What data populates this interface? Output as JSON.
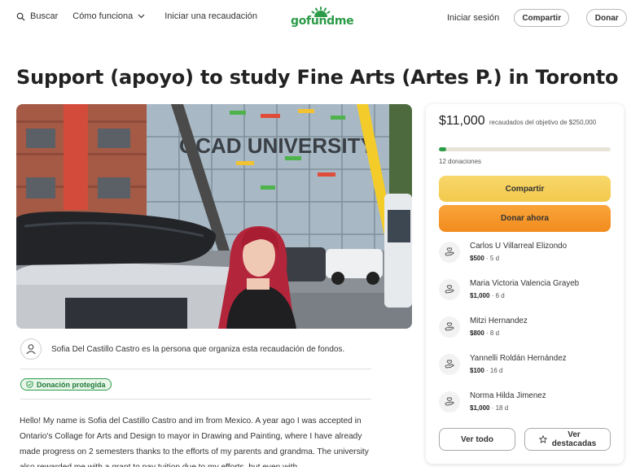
{
  "header": {
    "search_label": "Buscar",
    "how_it_works_label": "Cómo funciona",
    "start_fundraiser_label": "Iniciar una recaudación",
    "logo_text": "gofundme",
    "signin_label": "Iniciar sesión",
    "share_label": "Compartir",
    "donate_label": "Donar"
  },
  "campaign": {
    "title": "Support (apoyo) to study Fine Arts (Artes P.) in Toronto",
    "photo_sign_text": "OCAD UNIVERSITY",
    "organizer_text": "Sofia Del Castillo Castro es la persona que organiza esta recaudación de fondos.",
    "badge_label": "Donación protegida",
    "story": "Hello! My name is Sofia del Castillo Castro and im from Mexico. A year ago I was accepted in Ontario's Collage for Arts and Design to mayor in Drawing and Painting, where I have already made progress on 2 semesters thanks to the efforts of my parents and grandma. The university also rewarded me with a grant to pay tuition due to my efforts, but even with"
  },
  "sidebar": {
    "raised_amount": "$11,000",
    "raised_text": "recaudados del objetivo de $250,000",
    "progress_fraction": 0.044,
    "donation_count": "12 donaciones",
    "share_button": "Compartir",
    "donate_button": "Donar ahora",
    "donations": [
      {
        "name": "Carlos U Villarreal Elizondo",
        "amount": "$500",
        "time": "5 d"
      },
      {
        "name": "Maria Victoria Valencia Grayeb",
        "amount": "$1,000",
        "time": "6 d"
      },
      {
        "name": "Mitzi Hernandez",
        "amount": "$800",
        "time": "8 d"
      },
      {
        "name": "Yannelli Roldán Hernández",
        "amount": "$100",
        "time": "16 d"
      },
      {
        "name": "Norma Hilda Jimenez",
        "amount": "$1,000",
        "time": "18 d"
      }
    ],
    "see_all_button": "Ver todo",
    "see_top_line1": "Ver",
    "see_top_line2": "destacadas"
  },
  "colors": {
    "brand_green": "#2c9b48",
    "share_yellow": "#f2c94c",
    "donate_orange": "#f28b1e"
  }
}
